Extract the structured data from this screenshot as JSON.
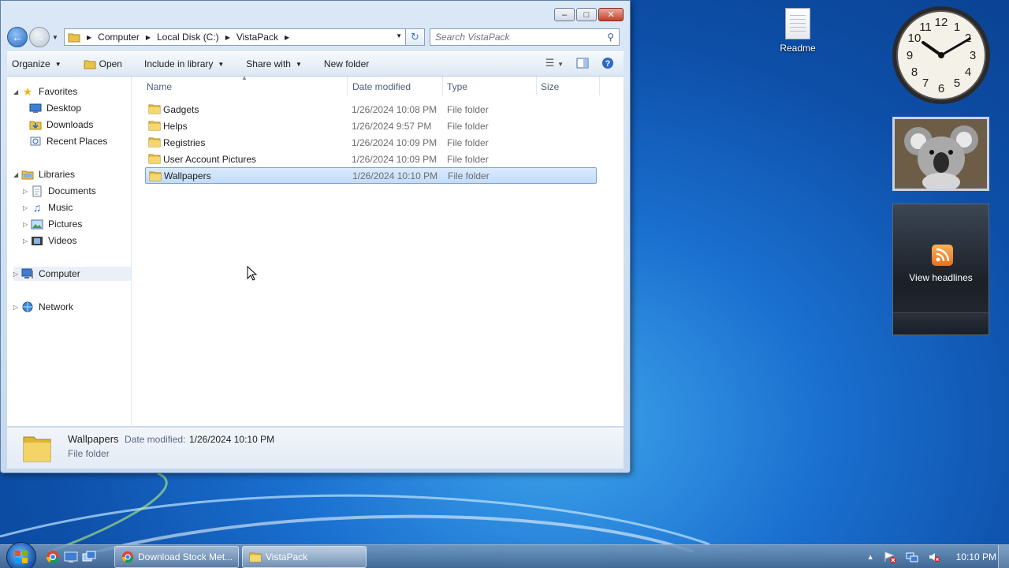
{
  "explorer": {
    "address": {
      "crumbs": [
        "Computer",
        "Local Disk (C:)",
        "VistaPack"
      ]
    },
    "search": {
      "placeholder": "Search VistaPack"
    },
    "toolbar": {
      "organize": "Organize",
      "open": "Open",
      "include_in_library": "Include in library",
      "share_with": "Share with",
      "new_folder": "New folder"
    },
    "nav": {
      "favorites": "Favorites",
      "desktop": "Desktop",
      "downloads": "Downloads",
      "recent_places": "Recent Places",
      "libraries": "Libraries",
      "documents": "Documents",
      "music": "Music",
      "pictures": "Pictures",
      "videos": "Videos",
      "computer": "Computer",
      "network": "Network"
    },
    "columns": {
      "name": "Name",
      "date_modified": "Date modified",
      "type": "Type",
      "size": "Size"
    },
    "files": [
      {
        "name": "Gadgets",
        "date": "1/26/2024 10:08 PM",
        "type": "File folder"
      },
      {
        "name": "Helps",
        "date": "1/26/2024 9:57 PM",
        "type": "File folder"
      },
      {
        "name": "Registries",
        "date": "1/26/2024 10:09 PM",
        "type": "File folder"
      },
      {
        "name": "User Account Pictures",
        "date": "1/26/2024 10:09 PM",
        "type": "File folder"
      },
      {
        "name": "Wallpapers",
        "date": "1/26/2024 10:10 PM",
        "type": "File folder",
        "selected": true
      }
    ],
    "details": {
      "name": "Wallpapers",
      "date_label": "Date modified:",
      "date_value": "1/26/2024 10:10 PM",
      "type": "File folder"
    }
  },
  "desktop": {
    "icons": [
      {
        "label": "Readme",
        "icon": "text-document-icon"
      }
    ],
    "clock": {
      "hour": 10,
      "minute": 10
    },
    "feed_gadget": {
      "label": "View headlines"
    }
  },
  "taskbar": {
    "buttons": [
      {
        "label": "Download Stock Met...",
        "icon": "chrome-icon"
      },
      {
        "label": "VistaPack",
        "icon": "folder-icon",
        "active": true
      }
    ],
    "time": "10:10 PM"
  },
  "colors": {
    "selection": "#cce4fc",
    "accent": "#3a7ad1"
  }
}
